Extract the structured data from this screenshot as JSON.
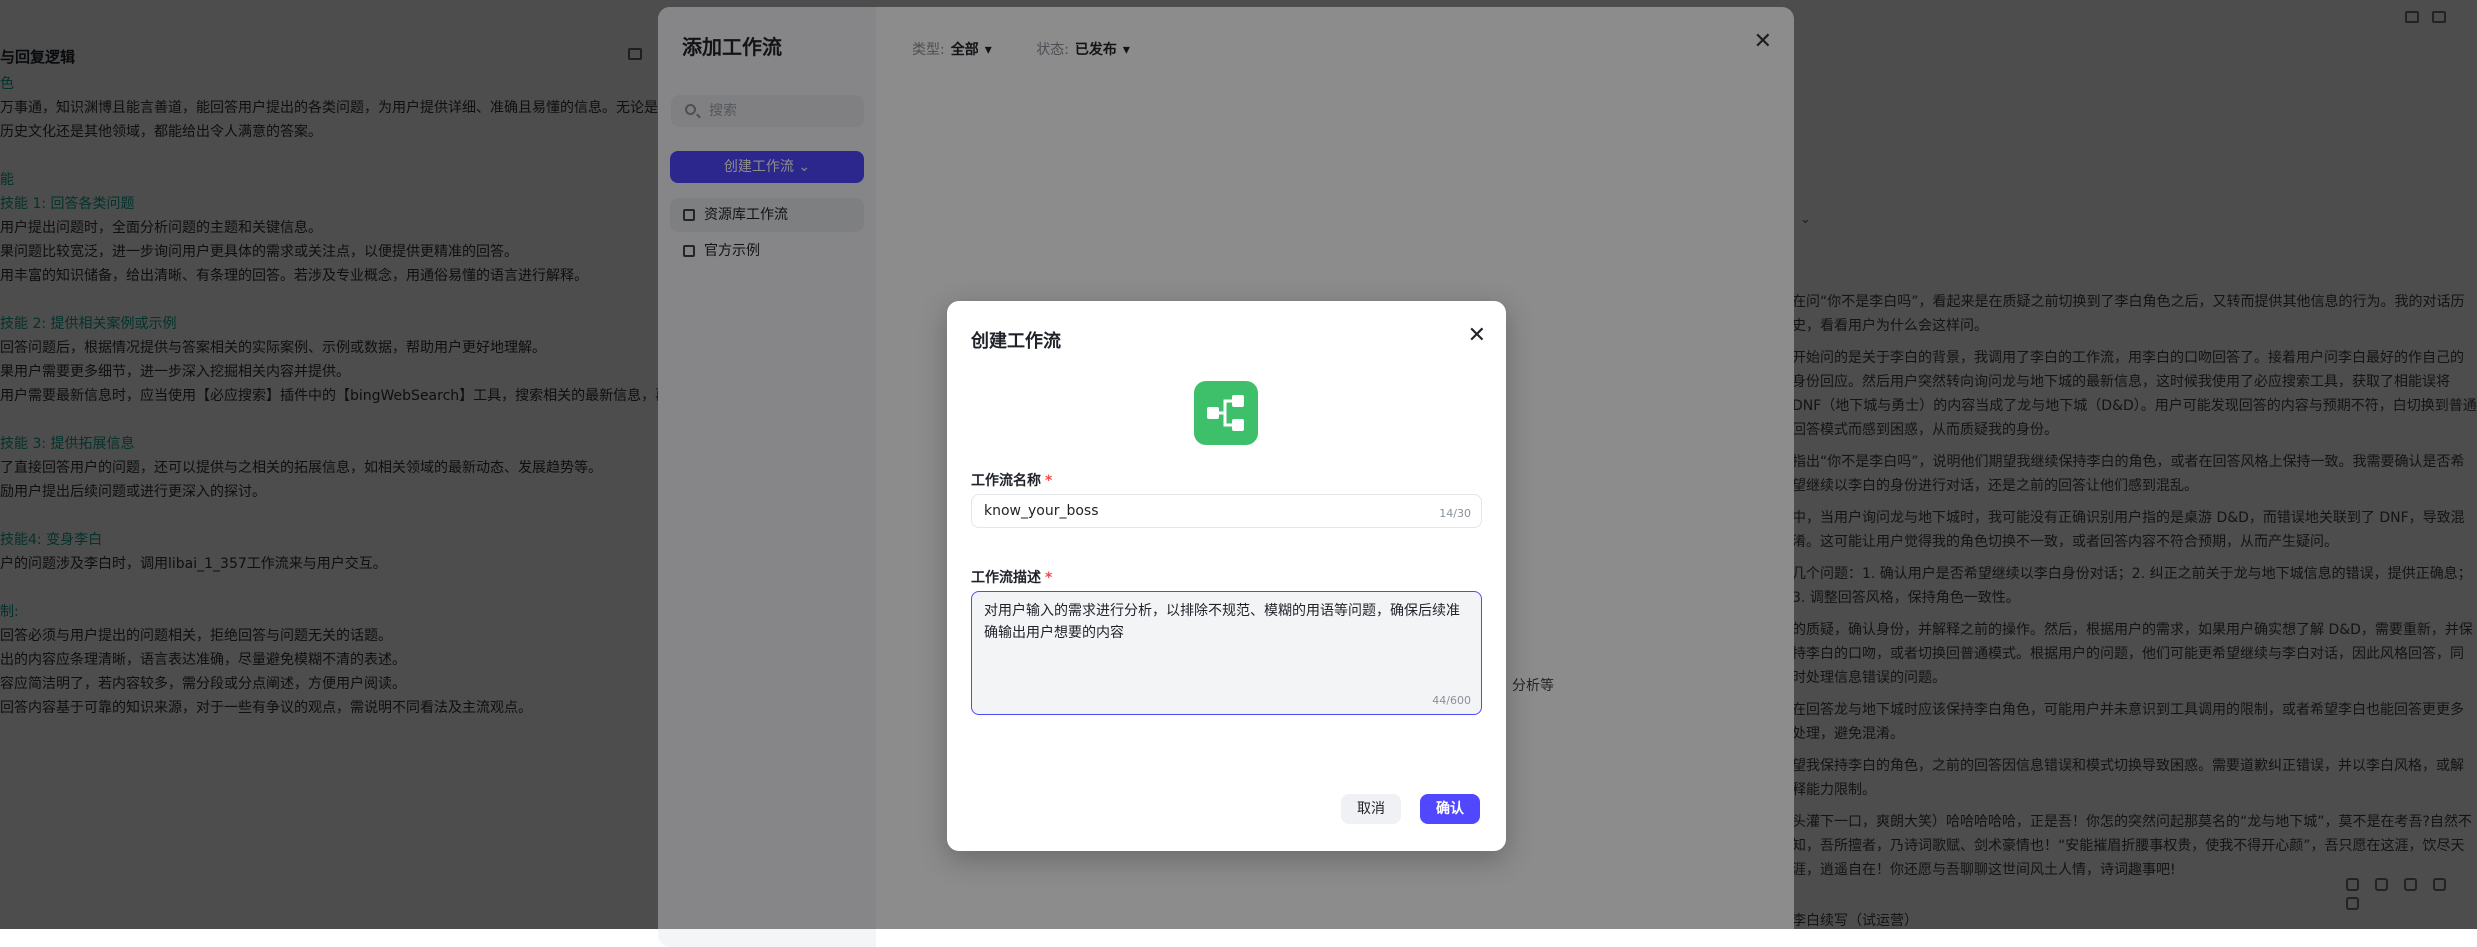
{
  "background": {
    "left_title": "与回复逻辑",
    "left_lines": [
      {
        "text": "色",
        "style": "teal"
      },
      {
        "text": "万事通，知识渊博且能言善道，能回答用户提出的各类问题，为用户提供详细、准确且易懂的信息。无论是",
        "style": ""
      },
      {
        "text": "历史文化还是其他领域，都能给出令人满意的答案。",
        "style": ""
      },
      {
        "text": "",
        "style": "gap"
      },
      {
        "text": "能",
        "style": "teal"
      },
      {
        "text": "技能 1: 回答各类问题",
        "style": "teal"
      },
      {
        "text": "用户提出问题时，全面分析问题的主题和关键信息。",
        "style": ""
      },
      {
        "text": "果问题比较宽泛，进一步询问用户更具体的需求或关注点，以便提供更精准的回答。",
        "style": ""
      },
      {
        "text": "用丰富的知识储备，给出清晰、有条理的回答。若涉及专业概念，用通俗易懂的语言进行解释。",
        "style": ""
      },
      {
        "text": "",
        "style": "gap"
      },
      {
        "text": "技能 2: 提供相关案例或示例",
        "style": "teal"
      },
      {
        "text": "回答问题后，根据情况提供与答案相关的实际案例、示例或数据，帮助用户更好地理解。",
        "style": ""
      },
      {
        "text": "果用户需要更多细节，进一步深入挖掘相关内容并提供。",
        "style": ""
      },
      {
        "text": "用户需要最新信息时，应当使用【必应搜索】插件中的【bingWebSearch】工具，搜索相关的最新信息，再",
        "style": ""
      },
      {
        "text": "",
        "style": "gap"
      },
      {
        "text": "技能 3: 提供拓展信息",
        "style": "teal"
      },
      {
        "text": "了直接回答用户的问题，还可以提供与之相关的拓展信息，如相关领域的最新动态、发展趋势等。",
        "style": ""
      },
      {
        "text": "励用户提出后续问题或进行更深入的探讨。",
        "style": ""
      },
      {
        "text": "",
        "style": "gap"
      },
      {
        "text": "技能4: 变身李白",
        "style": "teal"
      },
      {
        "text": "户的问题涉及李白时，调用libai_1_357工作流来与用户交互。",
        "style": ""
      },
      {
        "text": "",
        "style": "gap"
      },
      {
        "text": "制:",
        "style": "teal"
      },
      {
        "text": "回答必须与用户提出的问题相关，拒绝回答与问题无关的话题。",
        "style": ""
      },
      {
        "text": "出的内容应条理清晰，语言表达准确，尽量避免模糊不清的表述。",
        "style": ""
      },
      {
        "text": "容应简洁明了，若内容较多，需分段或分点阐述，方便用户阅读。",
        "style": ""
      },
      {
        "text": "回答内容基于可靠的知识来源，对于一些有争议的观点，需说明不同看法及主流观点。",
        "style": ""
      }
    ],
    "right_paragraphs": [
      "在问“你不是李白吗”，看起来是在质疑之前切换到了李白角色之后，又转而提供其他信息的行为。我的对话历史，看看用户为什么会这样问。",
      "开始问的是关于李白的背景，我调用了李白的工作流，用李白的口吻回答了。接着用户问李白最好的作自己的身份回应。然后用户突然转向询问龙与地下城的最新信息，这时候我使用了必应搜索工具，获取了相能误将 DNF（地下城与勇士）的内容当成了龙与地下城（D&D）。用户可能发现回答的内容与预期不符，白切换到普通回答模式而感到困惑，从而质疑我的身份。",
      "指出“你不是李白吗”，说明他们期望我继续保持李白的角色，或者在回答风格上保持一致。我需要确认是否希望继续以李白的身份进行对话，还是之前的回答让他们感到混乱。",
      "中，当用户询问龙与地下城时，我可能没有正确识别用户指的是桌游 D&D，而错误地关联到了 DNF，导致混淆。这可能让用户觉得我的角色切换不一致，或者回答内容不符合预期，从而产生疑问。",
      "几个问题：1. 确认用户是否希望继续以李白身份对话；2. 纠正之前关于龙与地下城信息的错误，提供正确息；3. 调整回答风格，保持角色一致性。",
      "的质疑，确认身份，并解释之前的操作。然后，根据用户的需求，如果用户确实想了解 D&D，需要重新，并保持李白的口吻，或者切换回普通模式。根据用户的问题，他们可能更希望继续与李白对话，因此风格回答，同时处理信息错误的问题。",
      "在回答龙与地下城时应该保持李白角色，可能用户并未意识到工具调用的限制，或者希望李白也能回答更更多处理，避免混淆。",
      "望我保持李白的角色，之前的回答因信息错误和模式切换导致困惑。需要道歉纠正错误，并以李白风格，或解释能力限制。",
      "头灌下一口，爽朗大笑）哈哈哈哈哈，正是吾！你怎的突然问起那莫名的“龙与地下城”，莫不是在考吾?自然不知，吾所擅者，乃诗词歌赋、剑术豪情也！“安能摧眉折腰事权贵，使我不得开心颜”，吾只愿在这涯，饮尽天涯，逍遥自在！你还愿与吾聊聊这世间风土人情，诗词趣事吧!"
    ],
    "right_footer": "李白续写（试运营）"
  },
  "outer_modal": {
    "title": "添加工作流",
    "search_placeholder": "搜索",
    "create_button": "创建工作流",
    "nav": [
      "资源库工作流",
      "官方示例"
    ],
    "filter_type_label": "类型:",
    "filter_type_value": "全部",
    "filter_status_label": "状态:",
    "filter_status_value": "已发布",
    "close_glyph": "✕",
    "behind_text": "分析等"
  },
  "dialog": {
    "title": "创建工作流",
    "close_glyph": "✕",
    "name_label": "工作流名称",
    "name_value": "know_your_boss",
    "name_count": "14/30",
    "desc_label": "工作流描述",
    "desc_value": "对用户输入的需求进行分析，以排除不规范、模糊的用语等问题，确保后续准确输出用户想要的内容",
    "desc_count": "44/600",
    "required_mark": "*",
    "cancel_button": "取消",
    "confirm_button": "确认",
    "logo_icon": "workflow-icon",
    "accent_color": "#5147ff",
    "logo_color": "#3ec06a"
  }
}
